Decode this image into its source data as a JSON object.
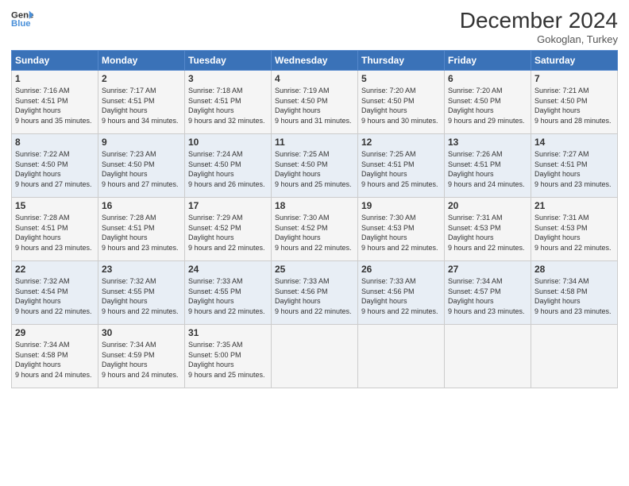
{
  "logo": {
    "line1": "General",
    "line2": "Blue"
  },
  "title": "December 2024",
  "location": "Gokoglan, Turkey",
  "days_of_week": [
    "Sunday",
    "Monday",
    "Tuesday",
    "Wednesday",
    "Thursday",
    "Friday",
    "Saturday"
  ],
  "weeks": [
    [
      {
        "day": "1",
        "sunrise": "7:16 AM",
        "sunset": "4:51 PM",
        "daylight": "9 hours and 35 minutes."
      },
      {
        "day": "2",
        "sunrise": "7:17 AM",
        "sunset": "4:51 PM",
        "daylight": "9 hours and 34 minutes."
      },
      {
        "day": "3",
        "sunrise": "7:18 AM",
        "sunset": "4:51 PM",
        "daylight": "9 hours and 32 minutes."
      },
      {
        "day": "4",
        "sunrise": "7:19 AM",
        "sunset": "4:50 PM",
        "daylight": "9 hours and 31 minutes."
      },
      {
        "day": "5",
        "sunrise": "7:20 AM",
        "sunset": "4:50 PM",
        "daylight": "9 hours and 30 minutes."
      },
      {
        "day": "6",
        "sunrise": "7:20 AM",
        "sunset": "4:50 PM",
        "daylight": "9 hours and 29 minutes."
      },
      {
        "day": "7",
        "sunrise": "7:21 AM",
        "sunset": "4:50 PM",
        "daylight": "9 hours and 28 minutes."
      }
    ],
    [
      {
        "day": "8",
        "sunrise": "7:22 AM",
        "sunset": "4:50 PM",
        "daylight": "9 hours and 27 minutes."
      },
      {
        "day": "9",
        "sunrise": "7:23 AM",
        "sunset": "4:50 PM",
        "daylight": "9 hours and 27 minutes."
      },
      {
        "day": "10",
        "sunrise": "7:24 AM",
        "sunset": "4:50 PM",
        "daylight": "9 hours and 26 minutes."
      },
      {
        "day": "11",
        "sunrise": "7:25 AM",
        "sunset": "4:50 PM",
        "daylight": "9 hours and 25 minutes."
      },
      {
        "day": "12",
        "sunrise": "7:25 AM",
        "sunset": "4:51 PM",
        "daylight": "9 hours and 25 minutes."
      },
      {
        "day": "13",
        "sunrise": "7:26 AM",
        "sunset": "4:51 PM",
        "daylight": "9 hours and 24 minutes."
      },
      {
        "day": "14",
        "sunrise": "7:27 AM",
        "sunset": "4:51 PM",
        "daylight": "9 hours and 23 minutes."
      }
    ],
    [
      {
        "day": "15",
        "sunrise": "7:28 AM",
        "sunset": "4:51 PM",
        "daylight": "9 hours and 23 minutes."
      },
      {
        "day": "16",
        "sunrise": "7:28 AM",
        "sunset": "4:51 PM",
        "daylight": "9 hours and 23 minutes."
      },
      {
        "day": "17",
        "sunrise": "7:29 AM",
        "sunset": "4:52 PM",
        "daylight": "9 hours and 22 minutes."
      },
      {
        "day": "18",
        "sunrise": "7:30 AM",
        "sunset": "4:52 PM",
        "daylight": "9 hours and 22 minutes."
      },
      {
        "day": "19",
        "sunrise": "7:30 AM",
        "sunset": "4:53 PM",
        "daylight": "9 hours and 22 minutes."
      },
      {
        "day": "20",
        "sunrise": "7:31 AM",
        "sunset": "4:53 PM",
        "daylight": "9 hours and 22 minutes."
      },
      {
        "day": "21",
        "sunrise": "7:31 AM",
        "sunset": "4:53 PM",
        "daylight": "9 hours and 22 minutes."
      }
    ],
    [
      {
        "day": "22",
        "sunrise": "7:32 AM",
        "sunset": "4:54 PM",
        "daylight": "9 hours and 22 minutes."
      },
      {
        "day": "23",
        "sunrise": "7:32 AM",
        "sunset": "4:55 PM",
        "daylight": "9 hours and 22 minutes."
      },
      {
        "day": "24",
        "sunrise": "7:33 AM",
        "sunset": "4:55 PM",
        "daylight": "9 hours and 22 minutes."
      },
      {
        "day": "25",
        "sunrise": "7:33 AM",
        "sunset": "4:56 PM",
        "daylight": "9 hours and 22 minutes."
      },
      {
        "day": "26",
        "sunrise": "7:33 AM",
        "sunset": "4:56 PM",
        "daylight": "9 hours and 22 minutes."
      },
      {
        "day": "27",
        "sunrise": "7:34 AM",
        "sunset": "4:57 PM",
        "daylight": "9 hours and 23 minutes."
      },
      {
        "day": "28",
        "sunrise": "7:34 AM",
        "sunset": "4:58 PM",
        "daylight": "9 hours and 23 minutes."
      }
    ],
    [
      {
        "day": "29",
        "sunrise": "7:34 AM",
        "sunset": "4:58 PM",
        "daylight": "9 hours and 24 minutes."
      },
      {
        "day": "30",
        "sunrise": "7:34 AM",
        "sunset": "4:59 PM",
        "daylight": "9 hours and 24 minutes."
      },
      {
        "day": "31",
        "sunrise": "7:35 AM",
        "sunset": "5:00 PM",
        "daylight": "9 hours and 25 minutes."
      },
      null,
      null,
      null,
      null
    ]
  ]
}
